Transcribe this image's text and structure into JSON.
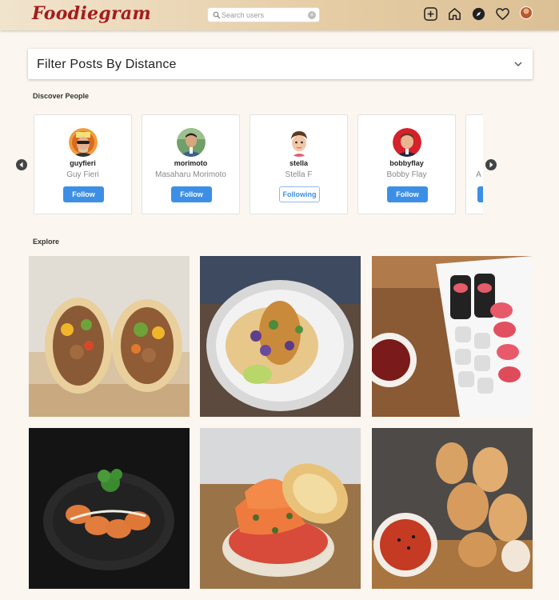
{
  "header": {
    "logo": "Foodiegram",
    "search": {
      "placeholder": "Search users",
      "value": ""
    },
    "icons": [
      "add-post-icon",
      "home-icon",
      "compass-icon",
      "heart-icon"
    ]
  },
  "filter": {
    "title": "Filter Posts By Distance"
  },
  "discover": {
    "label": "Discover People",
    "people": [
      {
        "username": "guyfieri",
        "name": "Guy Fieri",
        "button": "Follow",
        "following": false
      },
      {
        "username": "morimoto",
        "name": "Masaharu Morimoto",
        "button": "Follow",
        "following": false
      },
      {
        "username": "stella",
        "name": "Stella F",
        "button": "Following",
        "following": true
      },
      {
        "username": "bobbyflay",
        "name": "Bobby Flay",
        "button": "Follow",
        "following": false
      },
      {
        "username": "",
        "name": "A",
        "button": "",
        "following": false
      }
    ]
  },
  "explore": {
    "label": "Explore",
    "posts": [
      "burrito",
      "tacos",
      "sushi-rolls",
      "dark-plate-sushi",
      "salmon-bagel",
      "fried-chicken"
    ]
  },
  "colors": {
    "brand": "#a41d1d",
    "accent": "#3d8fe6",
    "background": "#fbf6ef"
  }
}
